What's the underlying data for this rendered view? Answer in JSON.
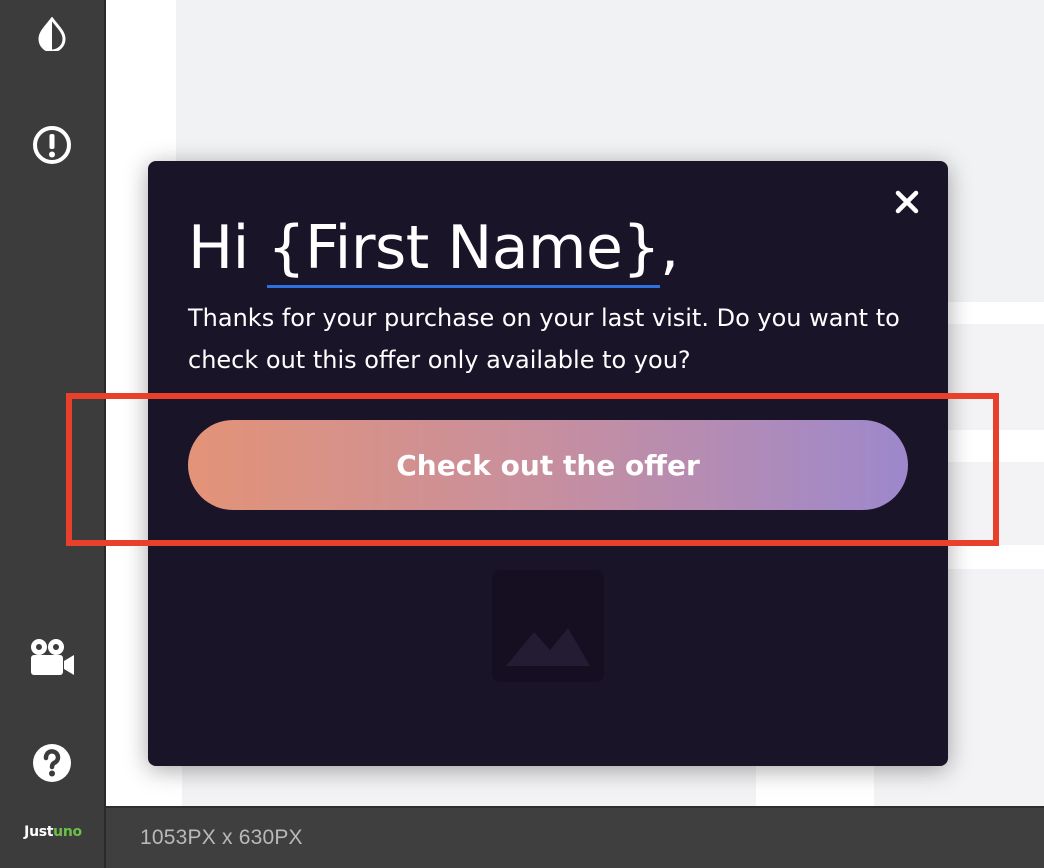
{
  "sidebar": {
    "icons": [
      "contrast-icon",
      "alert-icon",
      "video-camera-icon",
      "help-icon"
    ],
    "logo": {
      "part1": "Just",
      "part2": "uno"
    }
  },
  "bottombar": {
    "dimensions_label": "1053PX x 630PX"
  },
  "popup": {
    "headline_prefix": "Hi ",
    "merge_tag": "{First Name}",
    "headline_suffix": ",",
    "body": "Thanks for your purchase on your last visit. Do you want to check out this offer only available to you?",
    "button_label": "Check out the offer",
    "close_icon": "close-icon",
    "image_icon": "image-placeholder-icon"
  },
  "colors": {
    "popup_bg": "#1a1428",
    "button_gradient_start": "#e39377",
    "button_gradient_end": "#9d88cc",
    "merge_tag_underline": "#2f6fe0",
    "highlight": "#e8402a",
    "logo_accent": "#6cc04a"
  }
}
